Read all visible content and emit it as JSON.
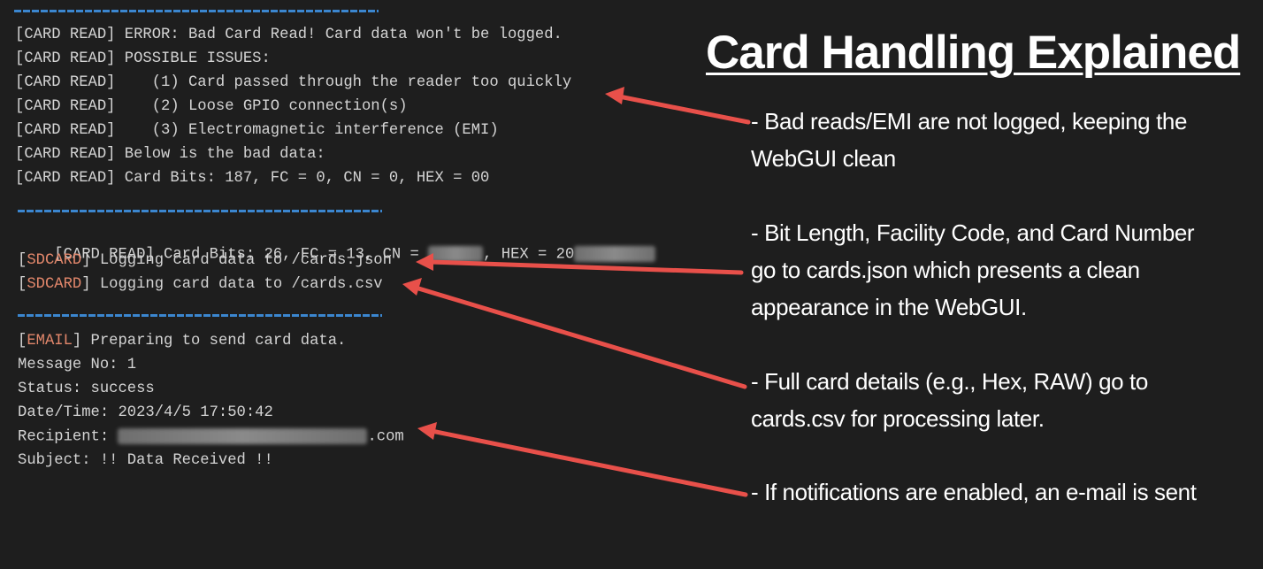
{
  "separator": "=========================================",
  "block1": {
    "lines": [
      {
        "tag": "[CARD READ]",
        "text": " ERROR: Bad Card Read! Card data won't be logged."
      },
      {
        "tag": "[CARD READ]",
        "text": " POSSIBLE ISSUES:"
      },
      {
        "tag": "[CARD READ]",
        "text": "    (1) Card passed through the reader too quickly"
      },
      {
        "tag": "[CARD READ]",
        "text": "    (2) Loose GPIO connection(s)"
      },
      {
        "tag": "[CARD READ]",
        "text": "    (3) Electromagnetic interference (EMI)"
      },
      {
        "tag": "[CARD READ]",
        "text": " Below is the bad data:"
      },
      {
        "tag": "[CARD READ]",
        "text": " Card Bits: 187, FC = 0, CN = 0, HEX = 00"
      }
    ]
  },
  "block2": {
    "card_read_prefix": "[CARD READ] Card Bits: 26, FC = 13, CN = ",
    "card_read_mid": ", HEX = 20",
    "sd1_tag": "SDCARD",
    "sd1_text": " Logging card data to /cards.json",
    "sd2_tag": "SDCARD",
    "sd2_text": " Logging card data to /cards.csv"
  },
  "block3": {
    "email_tag": "EMAIL",
    "email_text": " Preparing to send card data.",
    "message_no": "Message No: 1",
    "status": "Status: success",
    "datetime": "Date/Time: 2023/4/5 17:50:42",
    "recipient_label": "Recipient: ",
    "recipient_suffix": ".com",
    "subject": "Subject: !! Data Received !!"
  },
  "title": "Card Handling Explained",
  "notes": {
    "note1_line1": "- Bad reads/EMI are not logged, keeping the",
    "note1_line2": "WebGUI clean",
    "note2_line1": "- Bit Length, Facility Code, and Card Number",
    "note2_line2": "go to cards.json which presents a clean",
    "note2_line3": "appearance in the WebGUI.",
    "note3_line1": "- Full card details (e.g., Hex, RAW) go to",
    "note3_line2": "cards.csv for processing later.",
    "note4_line1": "- If notifications are enabled, an e-mail is sent"
  },
  "colors": {
    "background": "#1e1e1e",
    "separator": "#3b86cf",
    "tag_orange": "#e2876b",
    "arrow": "#e8504a"
  }
}
